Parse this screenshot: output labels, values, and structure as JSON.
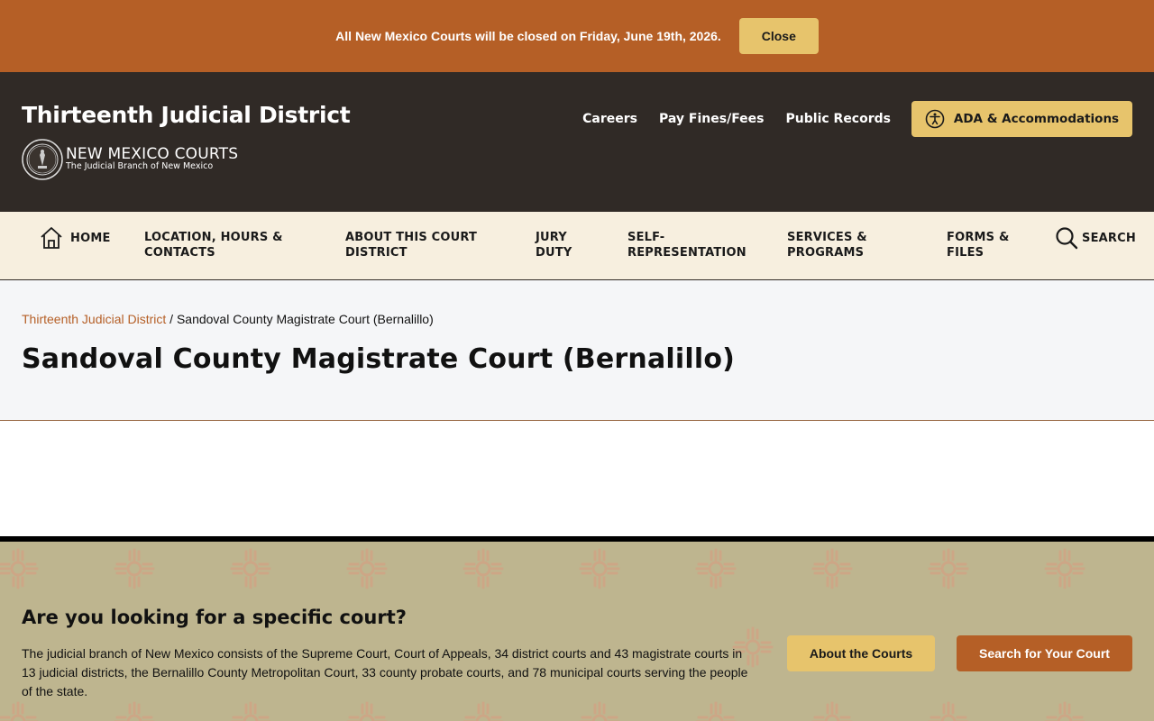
{
  "alert": {
    "message": "All New Mexico Courts will be closed on Friday, June 19th, 2026.",
    "close_label": "Close"
  },
  "header": {
    "site_title": "Thirteenth Judicial District",
    "logo_main": "NEW MEXICO COURTS",
    "logo_sub": "The Judicial Branch of New Mexico",
    "utility_links": [
      "Careers",
      "Pay Fines/Fees",
      "Public Records"
    ],
    "ada_label": "ADA & Accommodations"
  },
  "nav": {
    "home": "HOME",
    "location": "LOCATION, HOURS & CONTACTS",
    "about": "ABOUT THIS COURT DISTRICT",
    "jury": "JURY DUTY",
    "self_rep": "SELF-REPRESENTATION",
    "services": "SERVICES & PROGRAMS",
    "forms": "FORMS & FILES",
    "search": "SEARCH"
  },
  "breadcrumb": {
    "parent": "Thirteenth Judicial District",
    "separator": "/",
    "current": "Sandoval County Magistrate Court (Bernalillo)"
  },
  "page": {
    "title": "Sandoval County Magistrate Court (Bernalillo)"
  },
  "callout": {
    "title": "Are you looking for a specific court?",
    "body": "The judicial branch of New Mexico consists of the Supreme Court, Court of Appeals, 34 district courts and 43 magistrate courts in 13 judicial districts, the Bernalillo County Metropolitan Court, 33 county probate courts, and 78 municipal courts serving the people of the state.",
    "about_label": "About the Courts",
    "search_label": "Search for Your Court"
  },
  "colors": {
    "alert_bg": "#b55f26",
    "header_bg": "#302a26",
    "accent_gold": "#e7c46c",
    "nav_bg": "#f7efdf",
    "callout_bg": "#beb58f"
  }
}
